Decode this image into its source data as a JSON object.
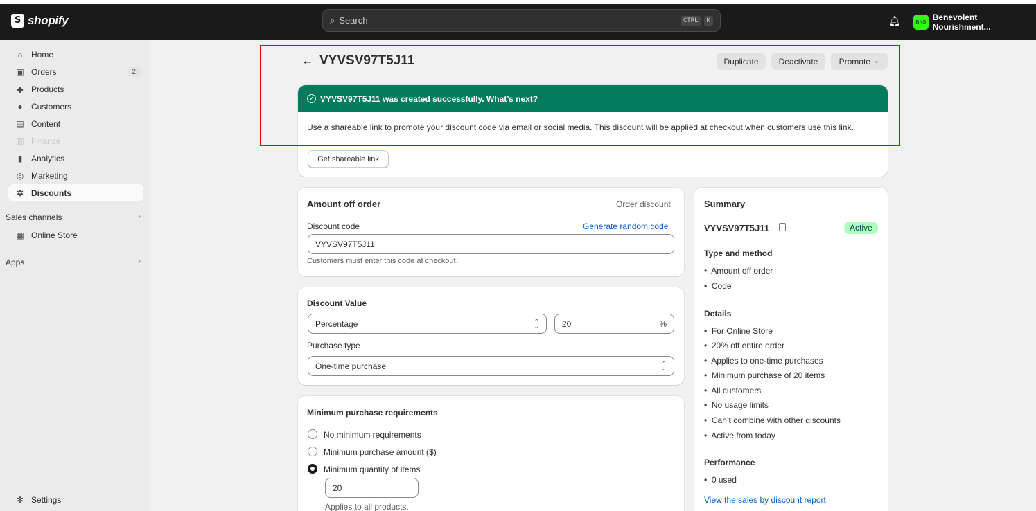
{
  "topbar": {
    "logo": "shopify",
    "search_placeholder": "Search",
    "shortcut_1": "CTRL",
    "shortcut_2": "K",
    "store_badge": "BNS",
    "store_name": "Benevolent Nourishment..."
  },
  "sidebar": {
    "items": [
      {
        "label": "Home",
        "icon": "home-icon"
      },
      {
        "label": "Orders",
        "icon": "inbox-icon",
        "count": "2"
      },
      {
        "label": "Products",
        "icon": "tag-icon"
      },
      {
        "label": "Customers",
        "icon": "person-icon"
      },
      {
        "label": "Content",
        "icon": "image-icon"
      },
      {
        "label": "Finance",
        "icon": "bank-icon"
      },
      {
        "label": "Analytics",
        "icon": "bar-chart-icon"
      },
      {
        "label": "Marketing",
        "icon": "target-icon"
      },
      {
        "label": "Discounts",
        "icon": "discount-icon"
      }
    ],
    "sales_channels": "Sales channels",
    "online_store": "Online Store",
    "apps": "Apps",
    "settings": "Settings"
  },
  "page": {
    "title": "VYVSV97T5J11",
    "duplicate": "Duplicate",
    "deactivate": "Deactivate",
    "promote": "Promote"
  },
  "banner": {
    "title": "VYVSV97T5J11 was created successfully. What’s next?",
    "body": "Use a shareable link to promote your discount code via email or social media. This discount will be applied at checkout when customers use this link.",
    "button": "Get shareable link"
  },
  "amount_card": {
    "title": "Amount off order",
    "type": "Order discount",
    "code_label": "Discount code",
    "generate": "Generate random code",
    "code_value": "VYVSV97T5J11",
    "help": "Customers must enter this code at checkout."
  },
  "value_card": {
    "title": "Discount Value",
    "value_type": "Percentage",
    "value": "20",
    "value_suffix": "%",
    "purchase_type_label": "Purchase type",
    "purchase_type": "One-time purchase"
  },
  "min_card": {
    "title": "Minimum purchase requirements",
    "options": [
      "No minimum requirements",
      "Minimum purchase amount ($)",
      "Minimum quantity of items"
    ],
    "selected_index": 2,
    "quantity": "20",
    "help": "Applies to all products."
  },
  "summary": {
    "title": "Summary",
    "code": "VYVSV97T5J11",
    "status": "Active",
    "type_heading": "Type and method",
    "type_items": [
      "Amount off order",
      "Code"
    ],
    "details_heading": "Details",
    "details_items": [
      "For Online Store",
      "20% off entire order",
      "Applies to one-time purchases",
      "Minimum purchase of 20 items",
      "All customers",
      "No usage limits",
      "Can’t combine with other discounts",
      "Active from today"
    ],
    "performance_heading": "Performance",
    "performance_items": [
      "0 used"
    ],
    "report_link": "View the sales by discount report"
  },
  "colors": {
    "banner_green": "#047b5d",
    "highlight_red": "#e00000",
    "link_blue": "#005bd3",
    "active_badge": "#affebf"
  }
}
